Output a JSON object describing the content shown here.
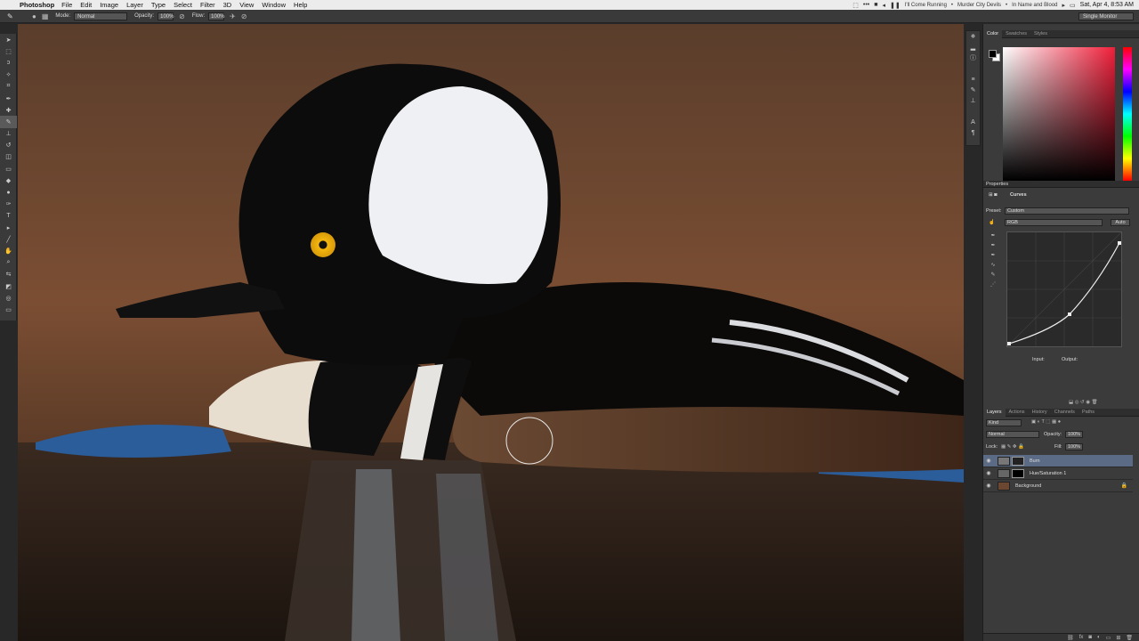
{
  "menubar": {
    "apple": "",
    "app": "Photoshop",
    "items": [
      "File",
      "Edit",
      "Image",
      "Layer",
      "Type",
      "Select",
      "Filter",
      "3D",
      "View",
      "Window",
      "Help"
    ],
    "song": "I'll Come Running",
    "artist": "Murder City Devils",
    "album": "In Name and Blood",
    "clock": "Sat, Apr 4, 8:53 AM"
  },
  "options": {
    "mode_label": "Mode:",
    "mode_value": "Normal",
    "opacity_label": "Opacity:",
    "opacity_value": "100%",
    "flow_label": "Flow:",
    "flow_value": "100%",
    "workspace": "Single Monitor"
  },
  "color_panel": {
    "tabs": [
      "Color",
      "Swatches",
      "Styles"
    ],
    "foreground": "#000000",
    "background": "#ffffff",
    "field_hue": "#f01f3a"
  },
  "properties": {
    "title": "Properties",
    "type": "Curves",
    "preset_label": "Preset:",
    "preset_value": "Custom",
    "channel_value": "RGB",
    "auto_label": "Auto",
    "input_label": "Input:",
    "output_label": "Output:"
  },
  "layers_panel": {
    "tabs": [
      "Layers",
      "Actions",
      "History",
      "Channels",
      "Paths"
    ],
    "kind_label": "Kind",
    "blend_value": "Normal",
    "opacity_label": "Opacity:",
    "opacity_value": "100%",
    "lock_label": "Lock:",
    "fill_label": "Fill:",
    "fill_value": "100%",
    "layers": [
      {
        "name": "Burn",
        "selected": true
      },
      {
        "name": "Hue/Saturation 1",
        "selected": false
      },
      {
        "name": "Background",
        "selected": false
      }
    ]
  }
}
